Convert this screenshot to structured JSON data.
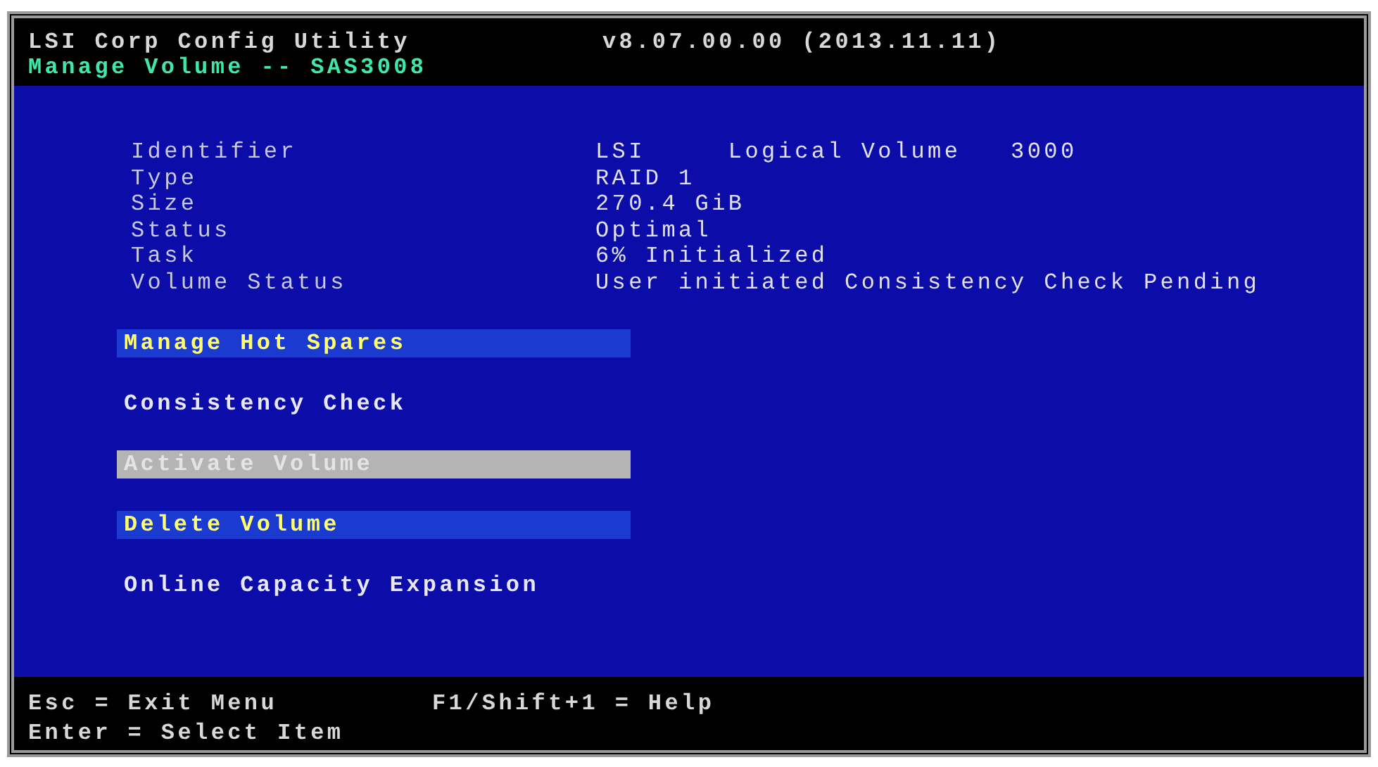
{
  "header": {
    "title": "LSI Corp Config Utility",
    "version": "v8.07.00.00 (2013.11.11)",
    "subtitle": "Manage Volume -- SAS3008"
  },
  "properties": [
    {
      "label": "Identifier",
      "value": "LSI     Logical Volume   3000"
    },
    {
      "label": "Type",
      "value": "RAID 1"
    },
    {
      "label": "Size",
      "value": "270.4 GiB"
    },
    {
      "label": "Status",
      "value": "Optimal"
    },
    {
      "label": "Task",
      "value": "6% Initialized"
    },
    {
      "label": "Volume Status",
      "value": "User initiated Consistency Check Pending"
    }
  ],
  "menu": [
    {
      "label": "Manage Hot Spares",
      "kind": "bar"
    },
    {
      "label": "Consistency Check",
      "kind": "plain"
    },
    {
      "label": "Activate Volume",
      "kind": "disabled"
    },
    {
      "label": "Delete Volume",
      "kind": "bar"
    },
    {
      "label": "Online Capacity Expansion",
      "kind": "plain"
    }
  ],
  "footer": {
    "left": [
      "Esc = Exit Menu",
      "Enter = Select Item"
    ],
    "right": "F1/Shift+1 = Help"
  }
}
